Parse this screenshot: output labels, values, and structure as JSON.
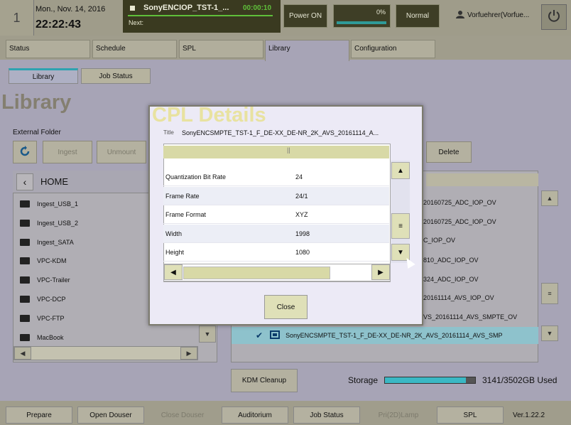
{
  "header": {
    "index": "1",
    "date": "Mon., Nov. 14, 2016",
    "time": "22:22:43",
    "play_title": "SonyENCIOP_TST-1_...",
    "play_timer": "00:00:10",
    "next_label": "Next:",
    "power_label": "Power ON",
    "progress_label": "0%",
    "progress_value": 0,
    "mode_label": "Normal",
    "user": "Vorfuehrer(Vorfue..."
  },
  "tabs": [
    "Status",
    "Schedule",
    "SPL",
    "Library",
    "Configuration"
  ],
  "subtabs": [
    "Library",
    "Job Status"
  ],
  "page_title": "Library",
  "external_folder_label": "External Folder",
  "toolbar": {
    "ingest": "Ingest",
    "unmount": "Unmount",
    "delete": "Delete"
  },
  "folder_list": {
    "home": "HOME",
    "items": [
      "Ingest_USB_1",
      "Ingest_USB_2",
      "Ingest_SATA",
      "VPC-KDM",
      "VPC-Trailer",
      "VPC-DCP",
      "VPC-FTP",
      "MacBook"
    ]
  },
  "right_list": {
    "items": [
      "20160725_ADC_IOP_OV",
      "20160725_ADC_IOP_OV",
      "C_IOP_OV",
      "810_ADC_IOP_OV",
      "324_ADC_IOP_OV",
      "20161114_AVS_IOP_OV",
      "VS_20161114_AVS_SMPTE_OV"
    ],
    "selected": "SonyENCSMPTE_TST-1_F_DE-XX_DE-NR_2K_AVS_20161114_AVS_SMP"
  },
  "kdm_cleanup": "KDM Cleanup",
  "storage": {
    "label": "Storage",
    "text": "3141/3502GB Used",
    "used_fraction": 0.897
  },
  "dialog": {
    "title": "CPL Details",
    "title_label": "Title",
    "title_value": "SonyENCSMPTE_TST-1_F_DE-XX_DE-NR_2K_AVS_20161114_A...",
    "rows": [
      {
        "key": "Quantization Bit Rate",
        "value": "24"
      },
      {
        "key": "Frame Rate",
        "value": "24/1"
      },
      {
        "key": "Frame Format",
        "value": "XYZ"
      },
      {
        "key": "Width",
        "value": "1998"
      },
      {
        "key": "Height",
        "value": "1080"
      }
    ],
    "close": "Close"
  },
  "bottom": {
    "prepare": "Prepare",
    "open_douser": "Open Douser",
    "close_douser": "Close Douser",
    "auditorium": "Auditorium",
    "job_status": "Job Status",
    "pri_lamp": "Pri(2D)Lamp",
    "spl": "SPL",
    "version": "Ver.1.22.2"
  }
}
